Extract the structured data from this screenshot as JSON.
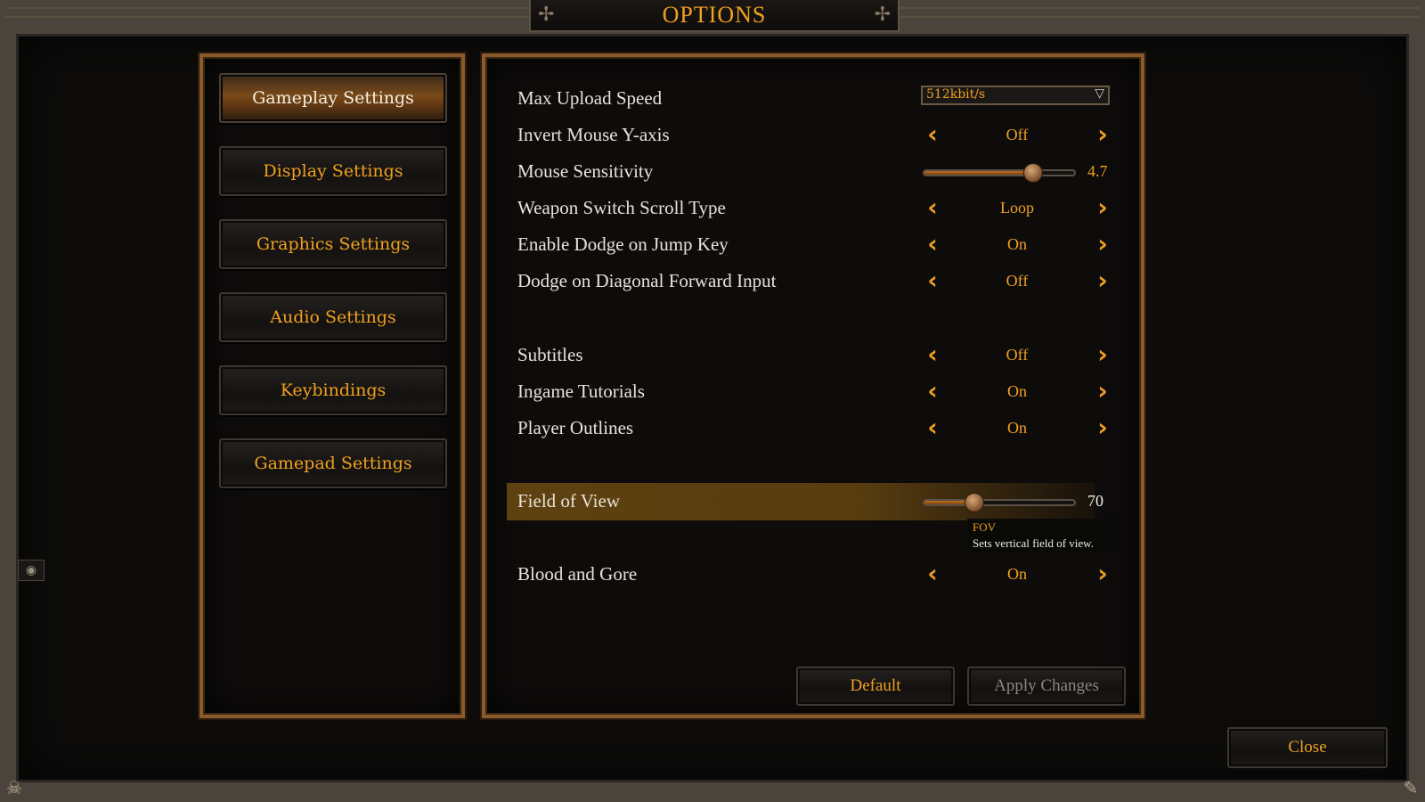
{
  "window": {
    "title": "OPTIONS"
  },
  "nav": [
    {
      "label": "Gameplay Settings",
      "active": true
    },
    {
      "label": "Display Settings",
      "active": false
    },
    {
      "label": "Graphics Settings",
      "active": false
    },
    {
      "label": "Audio Settings",
      "active": false
    },
    {
      "label": "Keybindings",
      "active": false
    },
    {
      "label": "Gamepad Settings",
      "active": false
    }
  ],
  "settings": {
    "max_upload_speed": {
      "label": "Max Upload Speed",
      "value": "512kbit/s"
    },
    "invert_mouse": {
      "label": "Invert Mouse Y-axis",
      "value": "Off"
    },
    "mouse_sensitivity": {
      "label": "Mouse Sensitivity",
      "value": "4.7",
      "fraction": 0.72
    },
    "weapon_switch": {
      "label": "Weapon Switch Scroll Type",
      "value": "Loop"
    },
    "dodge_jump": {
      "label": "Enable Dodge on Jump Key",
      "value": "On"
    },
    "dodge_diagonal": {
      "label": "Dodge on Diagonal Forward Input",
      "value": "Off"
    },
    "subtitles": {
      "label": "Subtitles",
      "value": "Off"
    },
    "tutorials": {
      "label": "Ingame Tutorials",
      "value": "On"
    },
    "outlines": {
      "label": "Player Outlines",
      "value": "On"
    },
    "fov": {
      "label": "Field of View",
      "value": "70",
      "fraction": 0.33
    },
    "blood": {
      "label": "Blood and Gore",
      "value": "On"
    }
  },
  "tooltip": {
    "title": "FOV",
    "body": "Sets vertical field of view."
  },
  "buttons": {
    "default": "Default",
    "apply": "Apply Changes",
    "close": "Close"
  },
  "colors": {
    "accent": "#f0a020",
    "label": "#e8e2d8",
    "disabled": "#8a8680",
    "frame": "#8a5a2a"
  },
  "icons": {
    "prev": "chevron-left-icon",
    "next": "chevron-right-icon",
    "dropdown": "chevron-down-icon",
    "corner_left": "skull-icon",
    "corner_right": "wrench-icon"
  }
}
